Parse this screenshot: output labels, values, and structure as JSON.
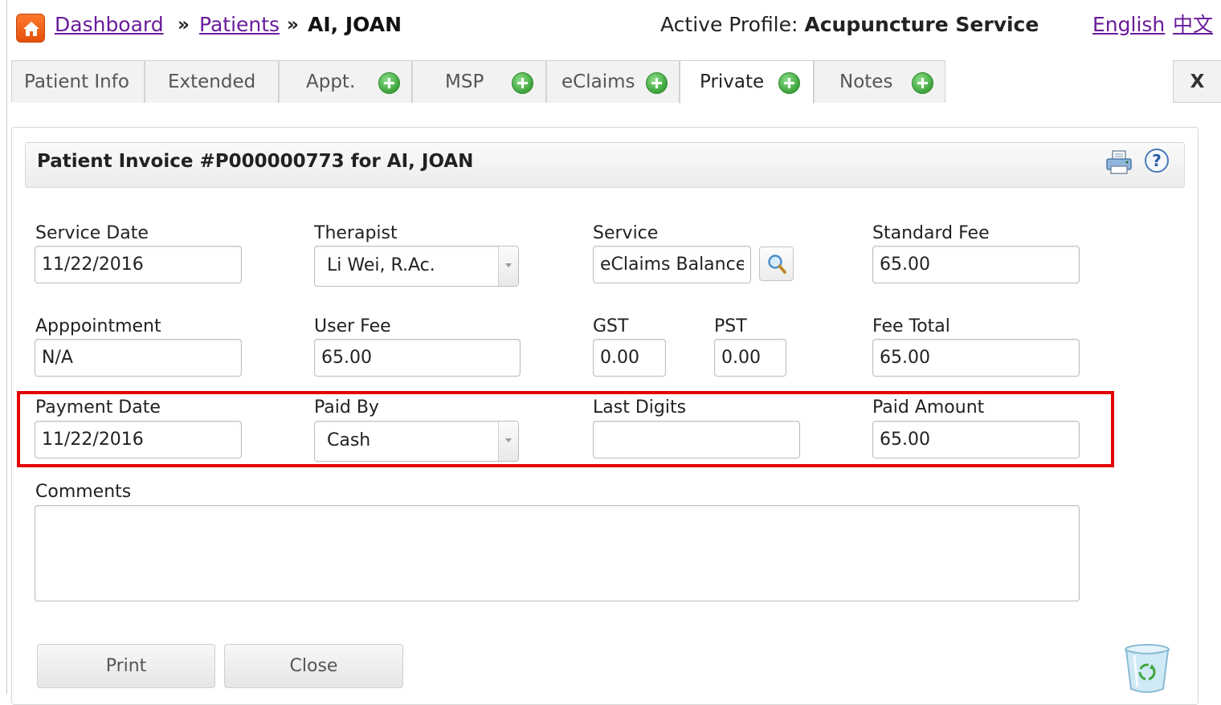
{
  "breadcrumb": {
    "dashboard": "Dashboard",
    "sep": "»",
    "patients": "Patients",
    "current": "AI, JOAN"
  },
  "profile": {
    "prefix": "Active Profile:",
    "name": "Acupuncture Service"
  },
  "languages": {
    "english": "English",
    "chinese": "中文"
  },
  "tabs": [
    {
      "label": "Patient Info"
    },
    {
      "label": "Extended"
    },
    {
      "label": "Appt."
    },
    {
      "label": "MSP"
    },
    {
      "label": "eClaims"
    },
    {
      "label": "Private"
    },
    {
      "label": "Notes"
    }
  ],
  "active_tab": "Private",
  "close_tab_label": "X",
  "invoice": {
    "title": "Patient Invoice #P000000773 for AI, JOAN"
  },
  "help_label": "?",
  "form": {
    "service_date": {
      "label": "Service Date",
      "value": "11/22/2016"
    },
    "therapist": {
      "label": "Therapist",
      "value": "Li Wei, R.Ac."
    },
    "service": {
      "label": "Service",
      "value": "eClaims Balance"
    },
    "standard_fee": {
      "label": "Standard Fee",
      "value": "65.00"
    },
    "appointment": {
      "label": "Apppointment",
      "value": "N/A"
    },
    "user_fee": {
      "label": "User Fee",
      "value": "65.00"
    },
    "gst": {
      "label": "GST",
      "value": "0.00"
    },
    "pst": {
      "label": "PST",
      "value": "0.00"
    },
    "fee_total": {
      "label": "Fee Total",
      "value": "65.00"
    },
    "payment_date": {
      "label": "Payment Date",
      "value": "11/22/2016"
    },
    "paid_by": {
      "label": "Paid By",
      "value": "Cash"
    },
    "last_digits": {
      "label": "Last Digits",
      "value": ""
    },
    "paid_amount": {
      "label": "Paid Amount",
      "value": "65.00"
    },
    "comments": {
      "label": "Comments",
      "value": ""
    }
  },
  "buttons": {
    "print": "Print",
    "close": "Close"
  },
  "colors": {
    "highlight": "#e30000",
    "link": "#6a1b9a",
    "add_icon": "#3ca33a",
    "home_icon": "#f26522"
  },
  "icons": [
    "home-icon",
    "plus-circle-icon",
    "print-icon",
    "help-icon",
    "search-icon",
    "recycle-bin-icon"
  ]
}
